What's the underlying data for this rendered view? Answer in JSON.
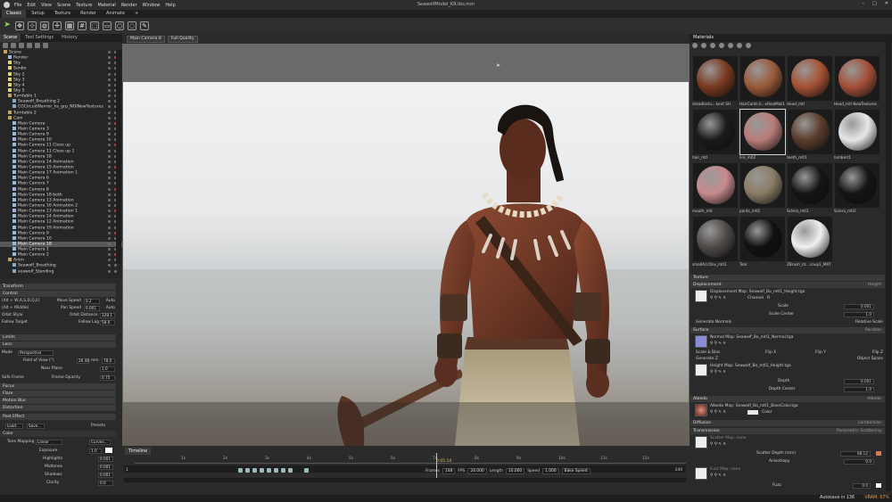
{
  "app": {
    "title": "SeawolfModel_KR.tbs.mm"
  },
  "menu": [
    "File",
    "Edit",
    "View",
    "Scene",
    "Texture",
    "Material",
    "Render",
    "Window",
    "Help"
  ],
  "workspace_tabs": [
    "Classic",
    "Setup",
    "Texture",
    "Render",
    "Animate",
    "+"
  ],
  "left_tabs": [
    "Scene",
    "Tool Settings",
    "History"
  ],
  "scene_tree": [
    {
      "label": "Scene",
      "type": "folder",
      "indent": 0
    },
    {
      "label": "Render",
      "type": "cam",
      "indent": 1
    },
    {
      "label": "Sky",
      "type": "light",
      "indent": 1
    },
    {
      "label": "Sunbo",
      "type": "light",
      "indent": 1
    },
    {
      "label": "Sky 2",
      "type": "light",
      "indent": 1
    },
    {
      "label": "Sky 3",
      "type": "light",
      "indent": 1
    },
    {
      "label": "Sky 4",
      "type": "light",
      "indent": 1
    },
    {
      "label": "Sky 5",
      "type": "light",
      "indent": 1
    },
    {
      "label": "Turntable 1",
      "type": "folder",
      "indent": 1
    },
    {
      "label": "Seawolf_Breathing 2",
      "type": "mesh",
      "indent": 2
    },
    {
      "label": "CGCircuitWarrior_hs_grp_NOINewTextures",
      "type": "mesh",
      "indent": 2
    },
    {
      "label": "Turntable 2",
      "type": "folder",
      "indent": 1
    },
    {
      "label": "Cam",
      "type": "folder",
      "indent": 1
    },
    {
      "label": "Main Camera",
      "type": "cam",
      "indent": 2
    },
    {
      "label": "Main Camera 3",
      "type": "cam",
      "indent": 2
    },
    {
      "label": "Main Camera 9",
      "type": "cam",
      "indent": 2
    },
    {
      "label": "Main Camera 10",
      "type": "cam",
      "indent": 2
    },
    {
      "label": "Main Camera 11 Close up",
      "type": "cam",
      "indent": 2
    },
    {
      "label": "Main Camera 11 Close up 1",
      "type": "cam",
      "indent": 2
    },
    {
      "label": "Main Camera 18",
      "type": "cam",
      "indent": 2
    },
    {
      "label": "Main Camera 14 Animation",
      "type": "cam",
      "indent": 2
    },
    {
      "label": "Main Camera 15 Animation",
      "type": "cam",
      "indent": 2
    },
    {
      "label": "Main Camera 17 Animation 1",
      "type": "cam",
      "indent": 2
    },
    {
      "label": "Main Camera 6",
      "type": "cam",
      "indent": 2
    },
    {
      "label": "Main Camera 7",
      "type": "cam",
      "indent": 2
    },
    {
      "label": "Main Camera 8",
      "type": "cam",
      "indent": 2
    },
    {
      "label": "Main Camera 18 both",
      "type": "cam",
      "indent": 2
    },
    {
      "label": "Main Camera 13 Animation",
      "type": "cam",
      "indent": 2
    },
    {
      "label": "Main Camera 16 Animation 2",
      "type": "cam",
      "indent": 2
    },
    {
      "label": "Main Camera 13 Animation 1",
      "type": "cam",
      "indent": 2
    },
    {
      "label": "Main Camera 14 Animation",
      "type": "cam",
      "indent": 2
    },
    {
      "label": "Main Camera 12 Animation",
      "type": "cam",
      "indent": 2
    },
    {
      "label": "Main Camera 19 Animation",
      "type": "cam",
      "indent": 2
    },
    {
      "label": "Main Camera 9",
      "type": "cam",
      "indent": 2
    },
    {
      "label": "Main Camera 10",
      "type": "cam",
      "indent": 2
    },
    {
      "label": "Main Camera 18",
      "type": "cam",
      "indent": 2,
      "selected": true
    },
    {
      "label": "Main Camera 1",
      "type": "cam",
      "indent": 2
    },
    {
      "label": "Main Camera 2",
      "type": "cam",
      "indent": 2
    },
    {
      "label": "Anim",
      "type": "folder",
      "indent": 1
    },
    {
      "label": "Seawolf_Breathing",
      "type": "mesh",
      "indent": 2
    },
    {
      "label": "seawolf_Standing",
      "type": "mesh",
      "indent": 2
    }
  ],
  "left_props": {
    "transform": "Transform",
    "control": "Control",
    "move_label": "(Alt + W,A,S,D,Q,E)",
    "move_speed_label": "Move Speed",
    "move_speed": "0.2",
    "auto": "Auto",
    "pan_label": "(Alt + Middle)",
    "pan_speed_label": "Pan Speed",
    "pan_speed": "0.001",
    "orbit_style": "Orbit Style",
    "orbit_distance_label": "Orbit Distance",
    "orbit_distance": "328.1",
    "follow_target": "Follow Target",
    "follow_lag_label": "Follow Lag",
    "follow_lag": "58.0",
    "limits": "Limits",
    "lens": "Lens",
    "mode_label": "Mode",
    "mode_value": "Perspective",
    "fov_label": "Field of View (°)",
    "fov": "26.46",
    "mm_label": "mm",
    "mm": "78.0",
    "near_plane_label": "Near Plane",
    "near_plane": "1.0",
    "safe_frame": "Safe Frame",
    "frame_opacity_label": "Frame Opacity",
    "frame_opacity": "0.75",
    "focus": "Focus",
    "flare": "Flare",
    "motion_blur": "Motion Blur",
    "distortion": "Distortion",
    "post_effect": "Post Effect",
    "load": "Load...",
    "save": "Save...",
    "presets": "Presets",
    "color": "Color",
    "tone_mapping_label": "Tone Mapping",
    "tone_mapping": "Linear",
    "curves": "Curves...",
    "exposure_label": "Exposure",
    "exposure": "1.0",
    "highlights_label": "Highlights",
    "highlights": "0.001",
    "midtones_label": "Midtones",
    "midtones": "0.001",
    "shadows_label": "Shadows",
    "shadows": "0.001",
    "clarity_label": "Clarity",
    "clarity": "0.0"
  },
  "viewport": {
    "camera": "Main Camera 8",
    "quality": "Full Quality"
  },
  "timeline": {
    "tab": "Timeline",
    "ticks": [
      "1s",
      "2s",
      "3s",
      "4s",
      "5s",
      "6s",
      "7s",
      "8s",
      "9s",
      "10s",
      "11s",
      "12s"
    ],
    "current_time": "0:05.14",
    "start": "1",
    "frames_label": "Frames",
    "frames": "148",
    "fps_label": "FPS",
    "fps": "24.000",
    "length_label": "Length",
    "length": "10.000",
    "speed_label": "Speed",
    "speed": "1.000",
    "bake_speed": "Bake Speed",
    "end": "240"
  },
  "materials": {
    "header": "Materials",
    "items": [
      {
        "label": "dreadlocks...kent SH",
        "color": "#7b3a20",
        "selected": false
      },
      {
        "label": "HairCards.h...eRealMat1",
        "color": "#9a5a3a",
        "selected": false
      },
      {
        "label": "Head_mtl",
        "color": "#a65234",
        "selected": false
      },
      {
        "label": "Head_mtl NewTextures",
        "color": "#a4503a",
        "selected": false
      },
      {
        "label": "hair_mtl",
        "color": "#1c1a19",
        "selected": false
      },
      {
        "label": "lire_mtl2",
        "color": "#b97d79",
        "selected": true
      },
      {
        "label": "teeth_mtl1",
        "color": "#5a3d2b",
        "selected": false
      },
      {
        "label": "lambert1",
        "color": "#e8e8e8",
        "selected": false
      },
      {
        "label": "mouth_mtl",
        "color": "#c88b8f",
        "selected": false
      },
      {
        "label": "pants_mtl1",
        "color": "#8a7c65",
        "selected": false
      },
      {
        "label": "Sclera_mtl1",
        "color": "#151515",
        "selected": false
      },
      {
        "label": "Sclera_mtl2",
        "color": "#151515",
        "selected": false
      },
      {
        "label": "smallAccOnv_mtl1",
        "color": "#4e4a48",
        "selected": false
      },
      {
        "label": "Tear",
        "color": "#101010",
        "selected": false
      },
      {
        "label": "ZBrush_dc...coup1_MAT",
        "color": "#f0f0f0",
        "selected": false
      }
    ]
  },
  "props": {
    "texture": "Texture",
    "displacement": "Displacement",
    "height": "Height",
    "displacement_map": "Displacement Map: Seawolf_Bo_mtl1_Height.tga",
    "channel_label": "Channel",
    "channel": "R",
    "scale_label": "Scale",
    "scale": "0.001",
    "scale_center_label": "Scale Center",
    "scale_center": "1.0",
    "generate_normals": "Generate Normals",
    "relative_scale": "Relative Scale",
    "surface": "Surface",
    "parallax": "Parallax",
    "normal_map": "Normal Map: Seawolf_Bo_mtl1_Normal.tga",
    "scale_bias": "Scale & Bias",
    "flip_x": "Flip X",
    "flip_y": "Flip Y",
    "flip_z": "Flip Z",
    "generate_z": "Generate Z",
    "object_space": "Object Space",
    "height_map": "Height Map: Seawolf_Bo_mtl1_Height.tga",
    "depth_label": "Depth",
    "depth": "0.001",
    "depth_center_label": "Depth Center",
    "depth_center": "1.0",
    "albedo": "Albedo",
    "albedo_mode": "Albedo",
    "albedo_map": "Albedo Map: Seawolf_Bo_mtl1_BaseColor.tga",
    "color_label": "Color",
    "diffusion": "Diffusion",
    "lambertian": "Lambertian",
    "transmission": "Transmission",
    "scattering_mode": "Parametric Scattering",
    "scatter_map": "Scatter Map: none",
    "scatter_depth_label": "Scatter Depth (mm)",
    "scatter_depth": "68.12",
    "anisotropy_label": "Anisotropy",
    "anisotropy": "0.0",
    "fuzz_map": "Fuzz Map: none",
    "fuzz_label": "Fuzz",
    "fuzz": "0.0"
  },
  "status": {
    "autosave": "Autosave in 136",
    "vram": "VRAM: 67%"
  }
}
